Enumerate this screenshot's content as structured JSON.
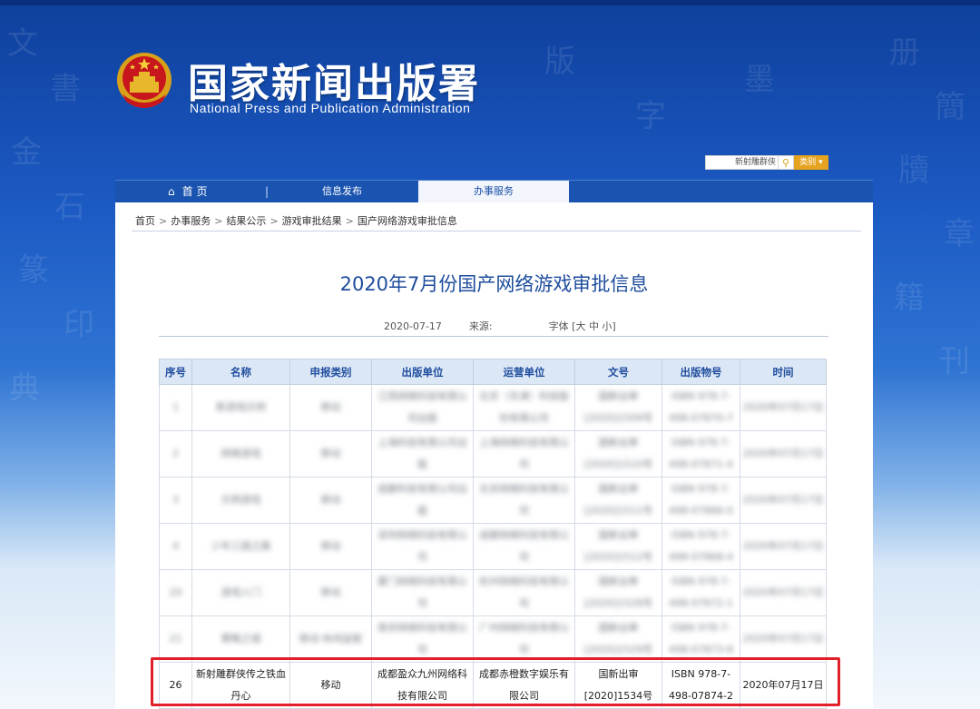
{
  "header": {
    "title": "国家新闻出版署",
    "subtitle": "National Press and Publication Administration",
    "search_value": "新射雕群侠",
    "search_category": "类别"
  },
  "nav": {
    "home": "首 页",
    "separator": "|",
    "info": "信息发布",
    "service": "办事服务"
  },
  "breadcrumb": [
    "首页",
    "办事服务",
    "结果公示",
    "游戏审批结果",
    "国产网络游戏审批信息"
  ],
  "article": {
    "title": "2020年7月份国产网络游戏审批信息",
    "date": "2020-07-17",
    "source_label": "来源:",
    "font_label": "字体 [大 中 小]"
  },
  "table": {
    "headers": [
      "序号",
      "名称",
      "申报类别",
      "出版单位",
      "运营单位",
      "文号",
      "出版物号",
      "时间"
    ],
    "blurred_rows": [
      [
        "1",
        "新游戏示例",
        "移动",
        "江西网络科技有限公司出版",
        "北京（天津）科技股份有限公司",
        "国新出审[2020]1509号",
        "ISBN 978-7-498-07870-7",
        "2020年07月17日"
      ],
      [
        "2",
        "网络游戏",
        "移动",
        "上海科技有限公司出版",
        "上海网络科技有限公司",
        "国新出审[2020]1510号",
        "ISBN 978-7-498-07871-4",
        "2020年07月17日"
      ],
      [
        "3",
        "示例游戏",
        "移动",
        "成都科技有限公司出版",
        "北京网络科技有限公司",
        "国新出审[2020]1511号",
        "ISBN 978-7-498-07866-0",
        "2020年07月17日"
      ],
      [
        "4",
        "少年三国之路",
        "移动",
        "深圳网络科技有限公司",
        "成都网络科技有限公司",
        "国新出审[2020]1512号",
        "ISBN 978-7-498-07868-4",
        "2020年07月17日"
      ],
      [
        "20",
        "游戏入门",
        "移动",
        "厦门网络科技有限公司",
        "杭州网络科技有限公司",
        "国新出审[2020]1528号",
        "ISBN 978-7-498-07872-1",
        "2020年07月17日"
      ],
      [
        "21",
        "策略之城",
        "移动·休闲益智",
        "南京网络科技有限公司",
        "广州网络科技有限公司",
        "国新出审[2020]1529号",
        "ISBN 978-7-498-07873-8",
        "2020年07月17日"
      ]
    ],
    "highlight_row": {
      "no": "26",
      "name": "新射雕群侠传之铁血丹心",
      "category": "移动",
      "publisher": "成都盈众九州网络科技有限公司",
      "operator": "成都赤橙数字娱乐有限公司",
      "approval": "国新出审[2020]1534号",
      "isbn": "ISBN 978-7-498-07874-2",
      "date": "2020年07月17日"
    }
  },
  "colors": {
    "header_blue": "#1b54b0",
    "title_blue": "#1f4d9d",
    "highlight_red": "#e1202a",
    "search_orange": "#e6a320"
  }
}
